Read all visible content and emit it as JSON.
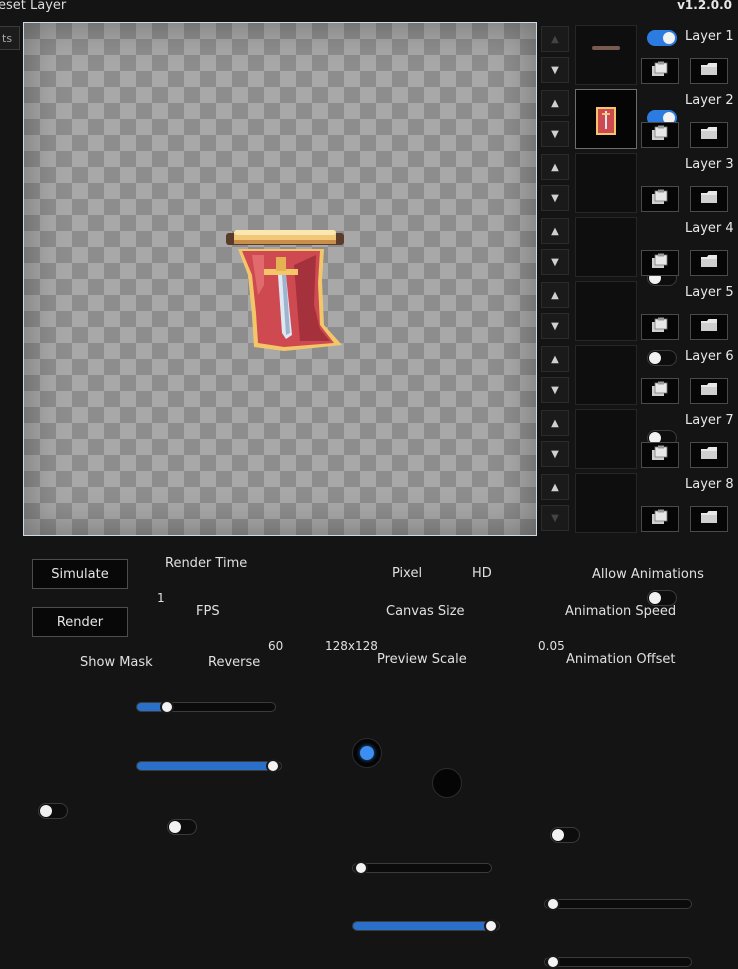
{
  "header": {
    "title": "eset Layer",
    "version": "v1.2.0.0",
    "side_tab": "ts"
  },
  "layers": [
    {
      "label": "Layer 1",
      "enabled": true
    },
    {
      "label": "Layer 2",
      "enabled": true
    },
    {
      "label": "Layer 3",
      "enabled": false
    },
    {
      "label": "Layer 4",
      "enabled": false
    },
    {
      "label": "Layer 5",
      "enabled": false
    },
    {
      "label": "Layer 6",
      "enabled": false
    },
    {
      "label": "Layer 7",
      "enabled": false
    },
    {
      "label": "Layer 8",
      "enabled": false
    }
  ],
  "controls": {
    "simulate_label": "Simulate",
    "render_label": "Render",
    "render_time": {
      "label": "Render Time",
      "value": "1",
      "fraction": 0.18
    },
    "fps": {
      "label": "FPS",
      "value": "60",
      "fraction": 1.0
    },
    "show_mask_label": "Show Mask",
    "reverse_label": "Reverse",
    "pixel_label": "Pixel",
    "hd_label": "HD",
    "canvas_size": {
      "label": "Canvas Size",
      "value": "128x128",
      "fraction": 0.0
    },
    "preview_scale": {
      "label": "Preview Scale",
      "fraction": 1.0
    },
    "allow_animations_label": "Allow Animations",
    "animation_speed": {
      "label": "Animation Speed",
      "value": "0.05",
      "fraction": 0.0
    },
    "animation_offset": {
      "label": "Animation Offset",
      "fraction": 0.0
    }
  },
  "colors": {
    "accent": "#2c7be0",
    "background": "#141414"
  }
}
